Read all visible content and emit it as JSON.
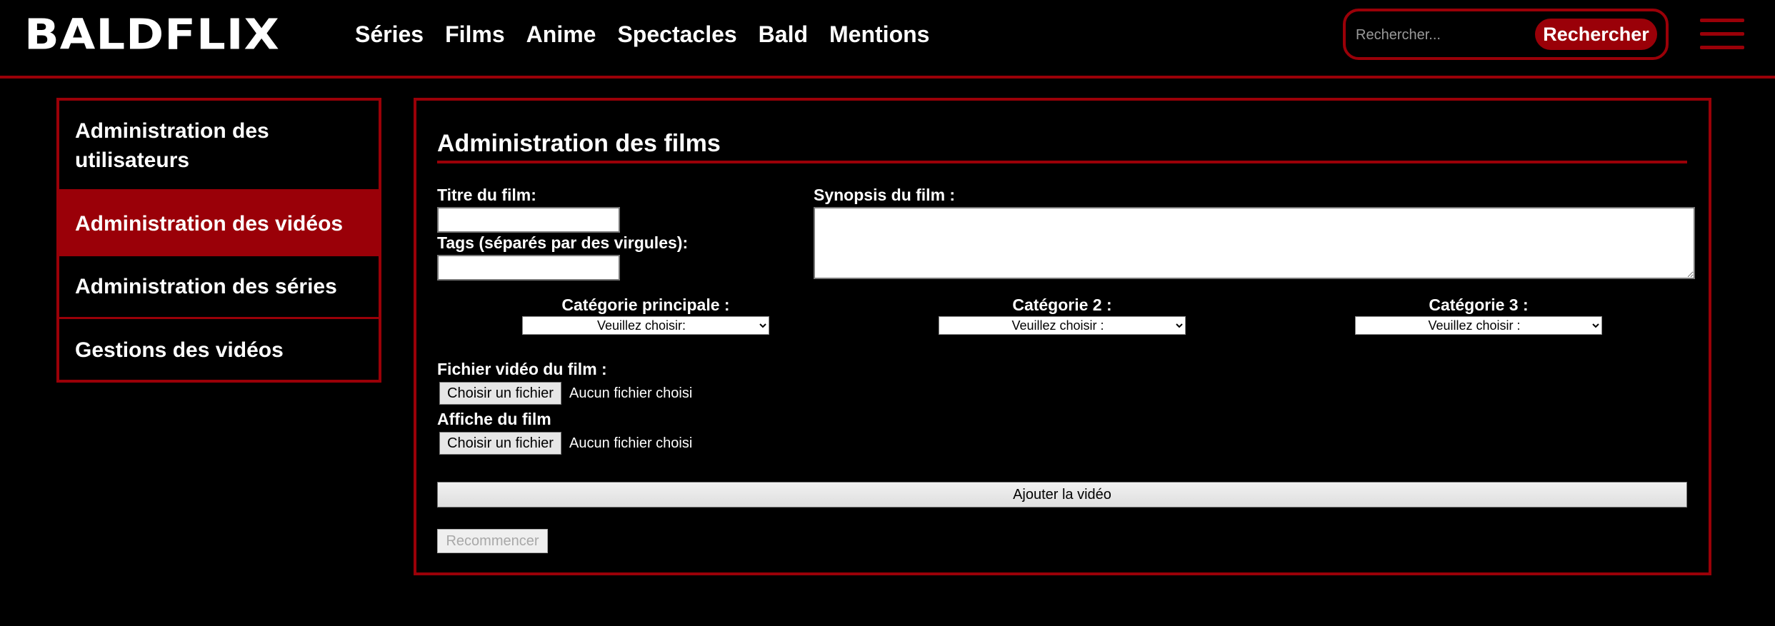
{
  "header": {
    "logo": "BALDFLIX",
    "nav": [
      "Séries",
      "Films",
      "Anime",
      "Spectacles",
      "Bald",
      "Mentions"
    ],
    "search": {
      "placeholder": "Rechercher...",
      "button": "Rechercher"
    }
  },
  "sidebar": {
    "items": [
      {
        "label": "Administration des utilisateurs",
        "active": false
      },
      {
        "label": "Administration des vidéos",
        "active": true
      },
      {
        "label": "Administration des séries",
        "active": false
      },
      {
        "label": "Gestions des vidéos",
        "active": false
      }
    ]
  },
  "form": {
    "title": "Administration des films",
    "film_title_label": "Titre du film:",
    "film_title_value": "",
    "tags_label": "Tags (séparés par des virgules):",
    "tags_value": "",
    "synopsis_label": "Synopsis du film :",
    "synopsis_value": "",
    "categories": [
      {
        "label": "Catégorie principale :",
        "selected": "Veuillez choisir:"
      },
      {
        "label": "Catégorie 2 :",
        "selected": "Veuillez choisir :"
      },
      {
        "label": "Catégorie 3 :",
        "selected": "Veuillez choisir :"
      }
    ],
    "video_file_label": "Fichier vidéo du film :",
    "poster_label": "Affiche du film",
    "file_button": "Choisir un fichier",
    "file_status": "Aucun fichier choisi",
    "submit_button": "Ajouter la vidéo",
    "reset_button": "Recommencer"
  },
  "colors": {
    "accent": "#9a0008",
    "background": "#000000",
    "text": "#ffffff"
  }
}
